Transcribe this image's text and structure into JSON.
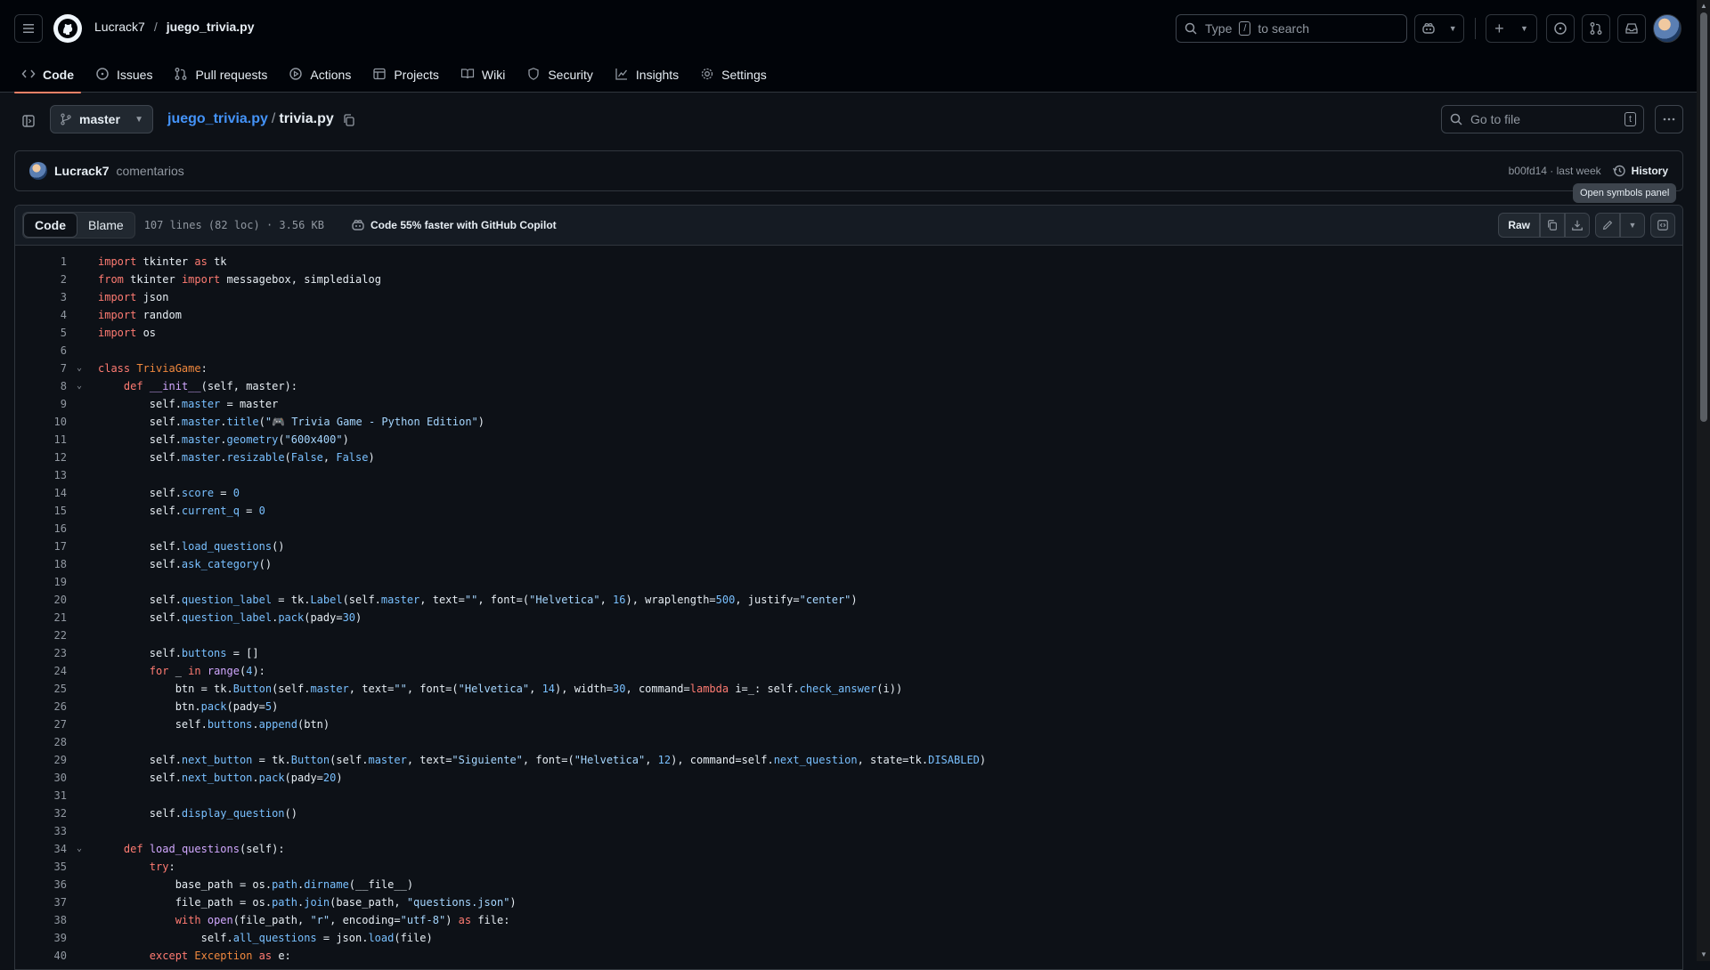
{
  "header": {
    "owner": "Lucrack7",
    "separator": "/",
    "repo": "juego_trivia.py",
    "search_prefix": "Type",
    "search_key": "/",
    "search_suffix": "to search",
    "plus_label": "+"
  },
  "tabs": [
    {
      "label": "Code",
      "icon": "code-icon"
    },
    {
      "label": "Issues",
      "icon": "issue-icon"
    },
    {
      "label": "Pull requests",
      "icon": "pull-request-icon"
    },
    {
      "label": "Actions",
      "icon": "play-icon"
    },
    {
      "label": "Projects",
      "icon": "table-icon"
    },
    {
      "label": "Wiki",
      "icon": "book-icon"
    },
    {
      "label": "Security",
      "icon": "shield-icon"
    },
    {
      "label": "Insights",
      "icon": "graph-icon"
    },
    {
      "label": "Settings",
      "icon": "gear-icon"
    }
  ],
  "filebar": {
    "branch": "master",
    "repo_link": "juego_trivia.py",
    "path_sep": "/",
    "filename": "trivia.py",
    "goto_placeholder": "Go to file",
    "goto_key": "t"
  },
  "commit": {
    "author": "Lucrack7",
    "message": "comentarios",
    "sha_time": "b00fd14 · last week",
    "history_label": "History"
  },
  "tooltip": "Open symbols panel",
  "code_toolbar": {
    "code_tab": "Code",
    "blame_tab": "Blame",
    "meta": "107 lines (82 loc) · 3.56 KB",
    "copilot_promo": "Code 55% faster with GitHub Copilot",
    "raw_label": "Raw"
  },
  "code": [
    {
      "n": "1",
      "fold": "",
      "html": "<span class=\"kw\">import</span> tkinter <span class=\"kw\">as</span> tk"
    },
    {
      "n": "2",
      "fold": "",
      "html": "<span class=\"kw\">from</span> tkinter <span class=\"kw\">import</span> messagebox, simpledialog"
    },
    {
      "n": "3",
      "fold": "",
      "html": "<span class=\"kw\">import</span> json"
    },
    {
      "n": "4",
      "fold": "",
      "html": "<span class=\"kw\">import</span> random"
    },
    {
      "n": "5",
      "fold": "",
      "html": "<span class=\"kw\">import</span> os"
    },
    {
      "n": "6",
      "fold": "",
      "html": ""
    },
    {
      "n": "7",
      "fold": "⌄",
      "html": "<span class=\"kw\">class</span> <span class=\"cls\">TriviaGame</span>:"
    },
    {
      "n": "8",
      "fold": "⌄",
      "html": "    <span class=\"kw\">def</span> <span class=\"fn\">__init__</span>(self, master):"
    },
    {
      "n": "9",
      "fold": "",
      "html": "        self.<span class=\"attr\">master</span> = master"
    },
    {
      "n": "10",
      "fold": "",
      "html": "        self.<span class=\"attr\">master</span>.<span class=\"attr\">title</span>(<span class=\"str\">\"🎮 Trivia Game - Python Edition\"</span>)"
    },
    {
      "n": "11",
      "fold": "",
      "html": "        self.<span class=\"attr\">master</span>.<span class=\"attr\">geometry</span>(<span class=\"str\">\"600x400\"</span>)"
    },
    {
      "n": "12",
      "fold": "",
      "html": "        self.<span class=\"attr\">master</span>.<span class=\"attr\">resizable</span>(<span class=\"num\">False</span>, <span class=\"num\">False</span>)"
    },
    {
      "n": "13",
      "fold": "",
      "html": ""
    },
    {
      "n": "14",
      "fold": "",
      "html": "        self.<span class=\"attr\">score</span> = <span class=\"num\">0</span>"
    },
    {
      "n": "15",
      "fold": "",
      "html": "        self.<span class=\"attr\">current_q</span> = <span class=\"num\">0</span>"
    },
    {
      "n": "16",
      "fold": "",
      "html": ""
    },
    {
      "n": "17",
      "fold": "",
      "html": "        self.<span class=\"attr\">load_questions</span>()"
    },
    {
      "n": "18",
      "fold": "",
      "html": "        self.<span class=\"attr\">ask_category</span>()"
    },
    {
      "n": "19",
      "fold": "",
      "html": ""
    },
    {
      "n": "20",
      "fold": "",
      "html": "        self.<span class=\"attr\">question_label</span> = tk.<span class=\"attr\">Label</span>(self.<span class=\"attr\">master</span>, text=<span class=\"str\">\"\"</span>, font=(<span class=\"str\">\"Helvetica\"</span>, <span class=\"num\">16</span>), wraplength=<span class=\"num\">500</span>, justify=<span class=\"str\">\"center\"</span>)"
    },
    {
      "n": "21",
      "fold": "",
      "html": "        self.<span class=\"attr\">question_label</span>.<span class=\"attr\">pack</span>(pady=<span class=\"num\">30</span>)"
    },
    {
      "n": "22",
      "fold": "",
      "html": ""
    },
    {
      "n": "23",
      "fold": "",
      "html": "        self.<span class=\"attr\">buttons</span> = []"
    },
    {
      "n": "24",
      "fold": "",
      "html": "        <span class=\"kw\">for</span> _ <span class=\"kw\">in</span> <span class=\"fn\">range</span>(<span class=\"num\">4</span>):"
    },
    {
      "n": "25",
      "fold": "",
      "html": "            btn = tk.<span class=\"attr\">Button</span>(self.<span class=\"attr\">master</span>, text=<span class=\"str\">\"\"</span>, font=(<span class=\"str\">\"Helvetica\"</span>, <span class=\"num\">14</span>), width=<span class=\"num\">30</span>, command=<span class=\"kw\">lambda</span> i=_: self.<span class=\"attr\">check_answer</span>(i))"
    },
    {
      "n": "26",
      "fold": "",
      "html": "            btn.<span class=\"attr\">pack</span>(pady=<span class=\"num\">5</span>)"
    },
    {
      "n": "27",
      "fold": "",
      "html": "            self.<span class=\"attr\">buttons</span>.<span class=\"attr\">append</span>(btn)"
    },
    {
      "n": "28",
      "fold": "",
      "html": ""
    },
    {
      "n": "29",
      "fold": "",
      "html": "        self.<span class=\"attr\">next_button</span> = tk.<span class=\"attr\">Button</span>(self.<span class=\"attr\">master</span>, text=<span class=\"str\">\"Siguiente\"</span>, font=(<span class=\"str\">\"Helvetica\"</span>, <span class=\"num\">12</span>), command=self.<span class=\"attr\">next_question</span>, state=tk.<span class=\"attr\">DISABLED</span>)"
    },
    {
      "n": "30",
      "fold": "",
      "html": "        self.<span class=\"attr\">next_button</span>.<span class=\"attr\">pack</span>(pady=<span class=\"num\">20</span>)"
    },
    {
      "n": "31",
      "fold": "",
      "html": ""
    },
    {
      "n": "32",
      "fold": "",
      "html": "        self.<span class=\"attr\">display_question</span>()"
    },
    {
      "n": "33",
      "fold": "",
      "html": ""
    },
    {
      "n": "34",
      "fold": "⌄",
      "html": "    <span class=\"kw\">def</span> <span class=\"fn\">load_questions</span>(self):"
    },
    {
      "n": "35",
      "fold": "",
      "html": "        <span class=\"kw\">try</span>:"
    },
    {
      "n": "36",
      "fold": "",
      "html": "            base_path = os.<span class=\"attr\">path</span>.<span class=\"attr\">dirname</span>(__file__)"
    },
    {
      "n": "37",
      "fold": "",
      "html": "            file_path = os.<span class=\"attr\">path</span>.<span class=\"attr\">join</span>(base_path, <span class=\"str\">\"questions.json\"</span>)"
    },
    {
      "n": "38",
      "fold": "",
      "html": "            <span class=\"kw\">with</span> <span class=\"fn\">open</span>(file_path, <span class=\"str\">\"r\"</span>, encoding=<span class=\"str\">\"utf-8\"</span>) <span class=\"kw\">as</span> file:"
    },
    {
      "n": "39",
      "fold": "",
      "html": "                self.<span class=\"attr\">all_questions</span> = json.<span class=\"attr\">load</span>(file)"
    },
    {
      "n": "40",
      "fold": "",
      "html": "        <span class=\"kw\">except</span> <span class=\"cls\">Exception</span> <span class=\"kw\">as</span> e:"
    }
  ]
}
